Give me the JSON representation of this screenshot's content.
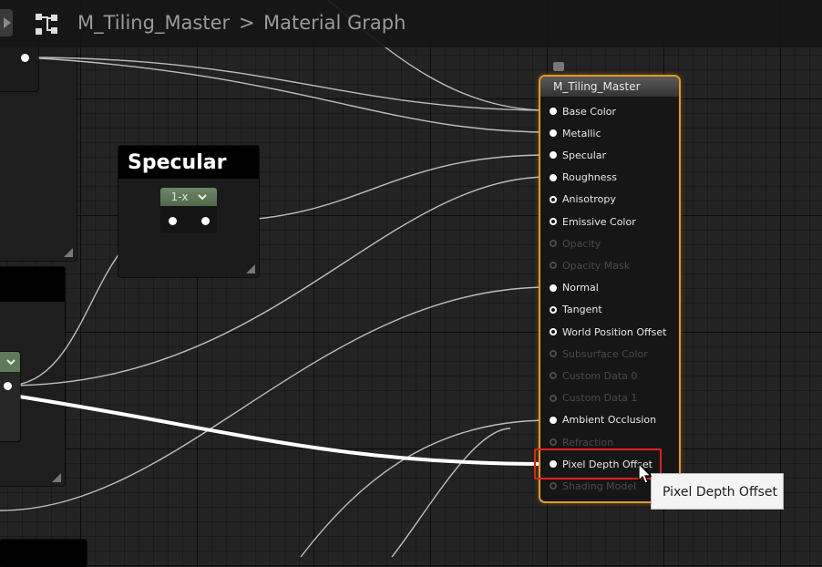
{
  "breadcrumb": {
    "asset": "M_Tiling_Master",
    "separator": ">",
    "graph": "Material Graph"
  },
  "icons": {
    "back": "play-arrow-icon",
    "graph": "graph-nodes-icon",
    "cursor": "mouse-cursor-icon"
  },
  "specular_node": {
    "title": "Specular",
    "inner_label": "1-x"
  },
  "master_node": {
    "title": "M_Tiling_Master",
    "pins": [
      {
        "label": "Base Color",
        "state": "connected"
      },
      {
        "label": "Metallic",
        "state": "connected"
      },
      {
        "label": "Specular",
        "state": "connected"
      },
      {
        "label": "Roughness",
        "state": "connected"
      },
      {
        "label": "Anisotropy",
        "state": "empty"
      },
      {
        "label": "Emissive Color",
        "state": "empty"
      },
      {
        "label": "Opacity",
        "state": "disabled"
      },
      {
        "label": "Opacity Mask",
        "state": "disabled"
      },
      {
        "label": "Normal",
        "state": "connected"
      },
      {
        "label": "Tangent",
        "state": "empty"
      },
      {
        "label": "World Position Offset",
        "state": "empty"
      },
      {
        "label": "Subsurface Color",
        "state": "disabled"
      },
      {
        "label": "Custom Data 0",
        "state": "disabled"
      },
      {
        "label": "Custom Data 1",
        "state": "disabled"
      },
      {
        "label": "Ambient Occlusion",
        "state": "connected"
      },
      {
        "label": "Refraction",
        "state": "disabled"
      },
      {
        "label": "Pixel Depth Offset",
        "state": "connected"
      },
      {
        "label": "Shading Model",
        "state": "disabled"
      }
    ]
  },
  "tooltip": {
    "text": "Pixel Depth Offset"
  },
  "colors": {
    "graph_bg": "#232323",
    "node_border_selected": "#e69a1f",
    "highlight_box": "#e0201c",
    "one_minus_header": "#5f7a58"
  }
}
